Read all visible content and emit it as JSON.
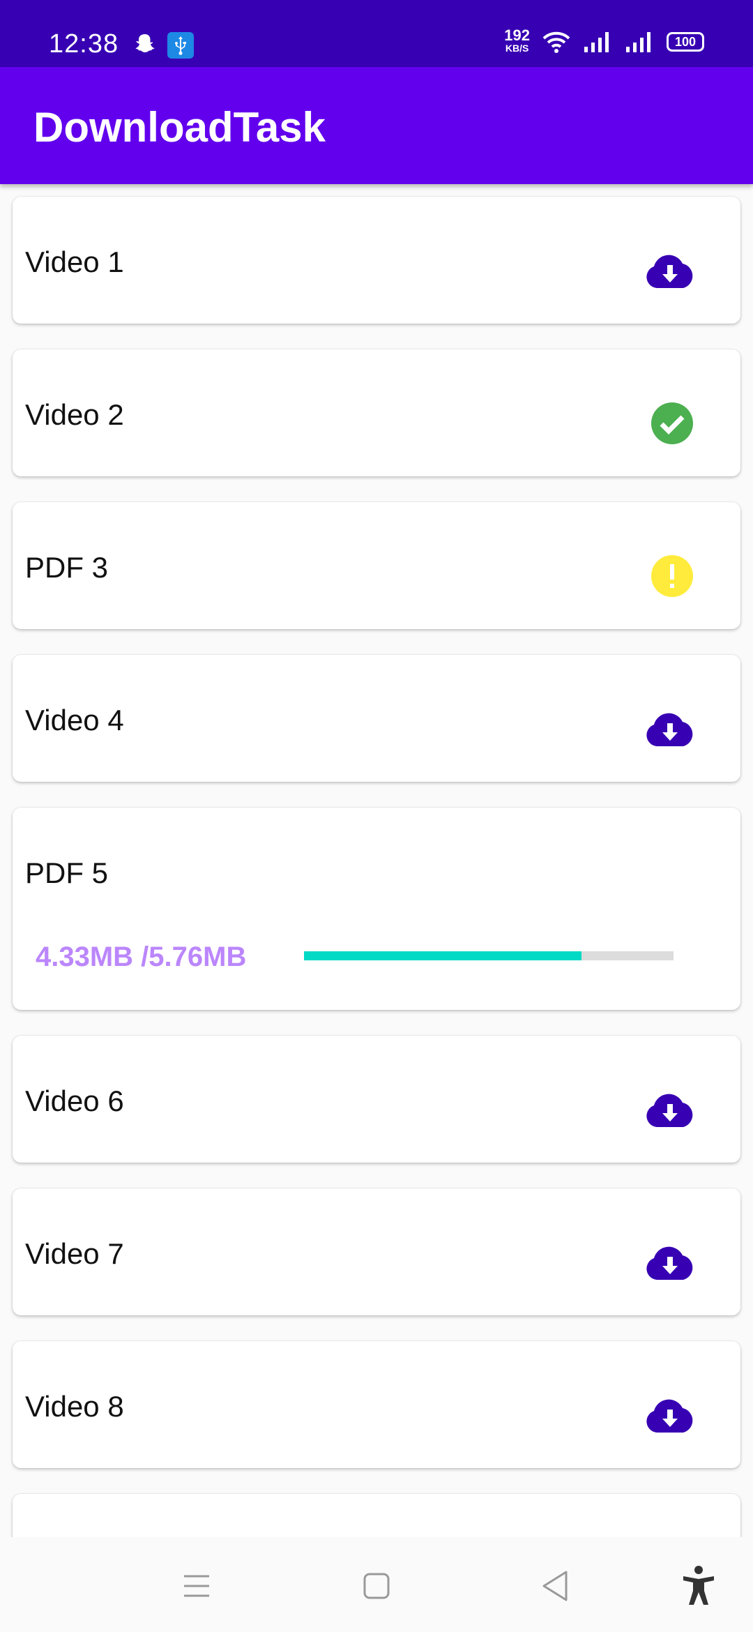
{
  "status_bar": {
    "time": "12:38",
    "speed_value": "192",
    "speed_unit": "KB/S",
    "battery": "100",
    "icons": [
      "snapchat-icon",
      "usb-icon",
      "wifi-icon",
      "signal-icon",
      "signal-icon",
      "battery-icon"
    ]
  },
  "app_bar": {
    "title": "DownloadTask"
  },
  "colors": {
    "status_bar": "#3700b3",
    "app_bar": "#6200ee",
    "download_icon": "#3700b3",
    "done_icon": "#4caf50",
    "warning_icon": "#ffeb3b",
    "progress_text": "#bb86fc",
    "progress_fill": "#03dac5"
  },
  "items": [
    {
      "title": "Video 1",
      "icon": "cloud-download-icon"
    },
    {
      "title": "Video 2",
      "icon": "check-circle-icon"
    },
    {
      "title": "PDF 3",
      "icon": "warning-circle-icon"
    },
    {
      "title": "Video 4",
      "icon": "cloud-download-icon"
    },
    {
      "title": "PDF 5",
      "progress_text": "4.33MB /5.76MB",
      "progress_fraction": 0.75
    },
    {
      "title": "Video 6",
      "icon": "cloud-download-icon"
    },
    {
      "title": "Video 7",
      "icon": "cloud-download-icon"
    },
    {
      "title": "Video 8",
      "icon": "cloud-download-icon"
    }
  ],
  "nav_bar": {
    "buttons": [
      "menu-icon",
      "home-icon",
      "back-icon",
      "accessibility-icon"
    ]
  }
}
